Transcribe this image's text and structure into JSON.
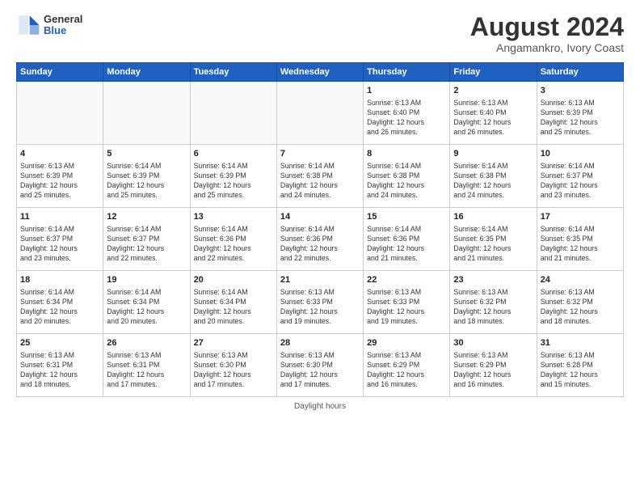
{
  "logo": {
    "general": "General",
    "blue": "Blue"
  },
  "title": "August 2024",
  "subtitle": "Angamankro, Ivory Coast",
  "days_of_week": [
    "Sunday",
    "Monday",
    "Tuesday",
    "Wednesday",
    "Thursday",
    "Friday",
    "Saturday"
  ],
  "footer_label": "Daylight hours",
  "weeks": [
    [
      {
        "day": "",
        "info": ""
      },
      {
        "day": "",
        "info": ""
      },
      {
        "day": "",
        "info": ""
      },
      {
        "day": "",
        "info": ""
      },
      {
        "day": "1",
        "info": "Sunrise: 6:13 AM\nSunset: 6:40 PM\nDaylight: 12 hours\nand 26 minutes."
      },
      {
        "day": "2",
        "info": "Sunrise: 6:13 AM\nSunset: 6:40 PM\nDaylight: 12 hours\nand 26 minutes."
      },
      {
        "day": "3",
        "info": "Sunrise: 6:13 AM\nSunset: 6:39 PM\nDaylight: 12 hours\nand 25 minutes."
      }
    ],
    [
      {
        "day": "4",
        "info": "Sunrise: 6:13 AM\nSunset: 6:39 PM\nDaylight: 12 hours\nand 25 minutes."
      },
      {
        "day": "5",
        "info": "Sunrise: 6:14 AM\nSunset: 6:39 PM\nDaylight: 12 hours\nand 25 minutes."
      },
      {
        "day": "6",
        "info": "Sunrise: 6:14 AM\nSunset: 6:39 PM\nDaylight: 12 hours\nand 25 minutes."
      },
      {
        "day": "7",
        "info": "Sunrise: 6:14 AM\nSunset: 6:38 PM\nDaylight: 12 hours\nand 24 minutes."
      },
      {
        "day": "8",
        "info": "Sunrise: 6:14 AM\nSunset: 6:38 PM\nDaylight: 12 hours\nand 24 minutes."
      },
      {
        "day": "9",
        "info": "Sunrise: 6:14 AM\nSunset: 6:38 PM\nDaylight: 12 hours\nand 24 minutes."
      },
      {
        "day": "10",
        "info": "Sunrise: 6:14 AM\nSunset: 6:37 PM\nDaylight: 12 hours\nand 23 minutes."
      }
    ],
    [
      {
        "day": "11",
        "info": "Sunrise: 6:14 AM\nSunset: 6:37 PM\nDaylight: 12 hours\nand 23 minutes."
      },
      {
        "day": "12",
        "info": "Sunrise: 6:14 AM\nSunset: 6:37 PM\nDaylight: 12 hours\nand 22 minutes."
      },
      {
        "day": "13",
        "info": "Sunrise: 6:14 AM\nSunset: 6:36 PM\nDaylight: 12 hours\nand 22 minutes."
      },
      {
        "day": "14",
        "info": "Sunrise: 6:14 AM\nSunset: 6:36 PM\nDaylight: 12 hours\nand 22 minutes."
      },
      {
        "day": "15",
        "info": "Sunrise: 6:14 AM\nSunset: 6:36 PM\nDaylight: 12 hours\nand 21 minutes."
      },
      {
        "day": "16",
        "info": "Sunrise: 6:14 AM\nSunset: 6:35 PM\nDaylight: 12 hours\nand 21 minutes."
      },
      {
        "day": "17",
        "info": "Sunrise: 6:14 AM\nSunset: 6:35 PM\nDaylight: 12 hours\nand 21 minutes."
      }
    ],
    [
      {
        "day": "18",
        "info": "Sunrise: 6:14 AM\nSunset: 6:34 PM\nDaylight: 12 hours\nand 20 minutes."
      },
      {
        "day": "19",
        "info": "Sunrise: 6:14 AM\nSunset: 6:34 PM\nDaylight: 12 hours\nand 20 minutes."
      },
      {
        "day": "20",
        "info": "Sunrise: 6:14 AM\nSunset: 6:34 PM\nDaylight: 12 hours\nand 20 minutes."
      },
      {
        "day": "21",
        "info": "Sunrise: 6:13 AM\nSunset: 6:33 PM\nDaylight: 12 hours\nand 19 minutes."
      },
      {
        "day": "22",
        "info": "Sunrise: 6:13 AM\nSunset: 6:33 PM\nDaylight: 12 hours\nand 19 minutes."
      },
      {
        "day": "23",
        "info": "Sunrise: 6:13 AM\nSunset: 6:32 PM\nDaylight: 12 hours\nand 18 minutes."
      },
      {
        "day": "24",
        "info": "Sunrise: 6:13 AM\nSunset: 6:32 PM\nDaylight: 12 hours\nand 18 minutes."
      }
    ],
    [
      {
        "day": "25",
        "info": "Sunrise: 6:13 AM\nSunset: 6:31 PM\nDaylight: 12 hours\nand 18 minutes."
      },
      {
        "day": "26",
        "info": "Sunrise: 6:13 AM\nSunset: 6:31 PM\nDaylight: 12 hours\nand 17 minutes."
      },
      {
        "day": "27",
        "info": "Sunrise: 6:13 AM\nSunset: 6:30 PM\nDaylight: 12 hours\nand 17 minutes."
      },
      {
        "day": "28",
        "info": "Sunrise: 6:13 AM\nSunset: 6:30 PM\nDaylight: 12 hours\nand 17 minutes."
      },
      {
        "day": "29",
        "info": "Sunrise: 6:13 AM\nSunset: 6:29 PM\nDaylight: 12 hours\nand 16 minutes."
      },
      {
        "day": "30",
        "info": "Sunrise: 6:13 AM\nSunset: 6:29 PM\nDaylight: 12 hours\nand 16 minutes."
      },
      {
        "day": "31",
        "info": "Sunrise: 6:13 AM\nSunset: 6:28 PM\nDaylight: 12 hours\nand 15 minutes."
      }
    ]
  ]
}
